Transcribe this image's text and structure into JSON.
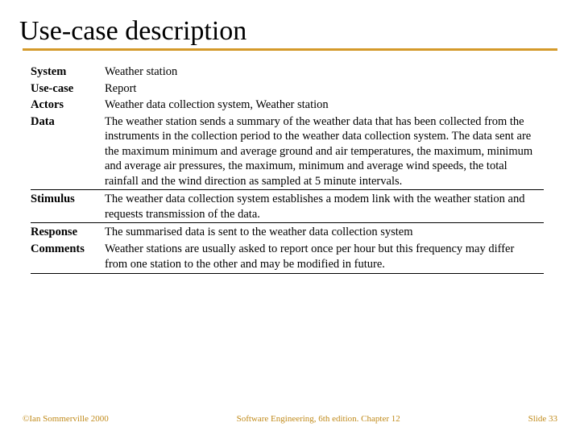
{
  "title": "Use-case description",
  "rows": [
    {
      "label": "System",
      "value": "Weather station"
    },
    {
      "label": "Use-case",
      "value": "Report"
    },
    {
      "label": "Actors",
      "value": "Weather data collection system, Weather station"
    },
    {
      "label": "Data",
      "value": "The weather station sends a summary of the weather data that has been collected from the instruments in the collection period to the weather data collection system. The data sent are the maximum minimum and average ground and air temperatures, the maximum, minimum and average air pressures, the maximum, minimum and average wind speeds, the total rainfall and the wind direction as sampled at 5 minute intervals."
    },
    {
      "label": "Stimulus",
      "value": "The weather data collection system establishes a modem link with the weather station and requests transmission of the data."
    },
    {
      "label": "Response",
      "value": "The summarised data is sent to the weather data collection system"
    },
    {
      "label": "Comments",
      "value": "Weather stations are usually asked to report once per hour but this frequency may differ from one station to the other and may be modified in future."
    }
  ],
  "footer": {
    "left": "©Ian Sommerville 2000",
    "center": "Software Engineering, 6th edition. Chapter 12",
    "right": "Slide 33"
  }
}
